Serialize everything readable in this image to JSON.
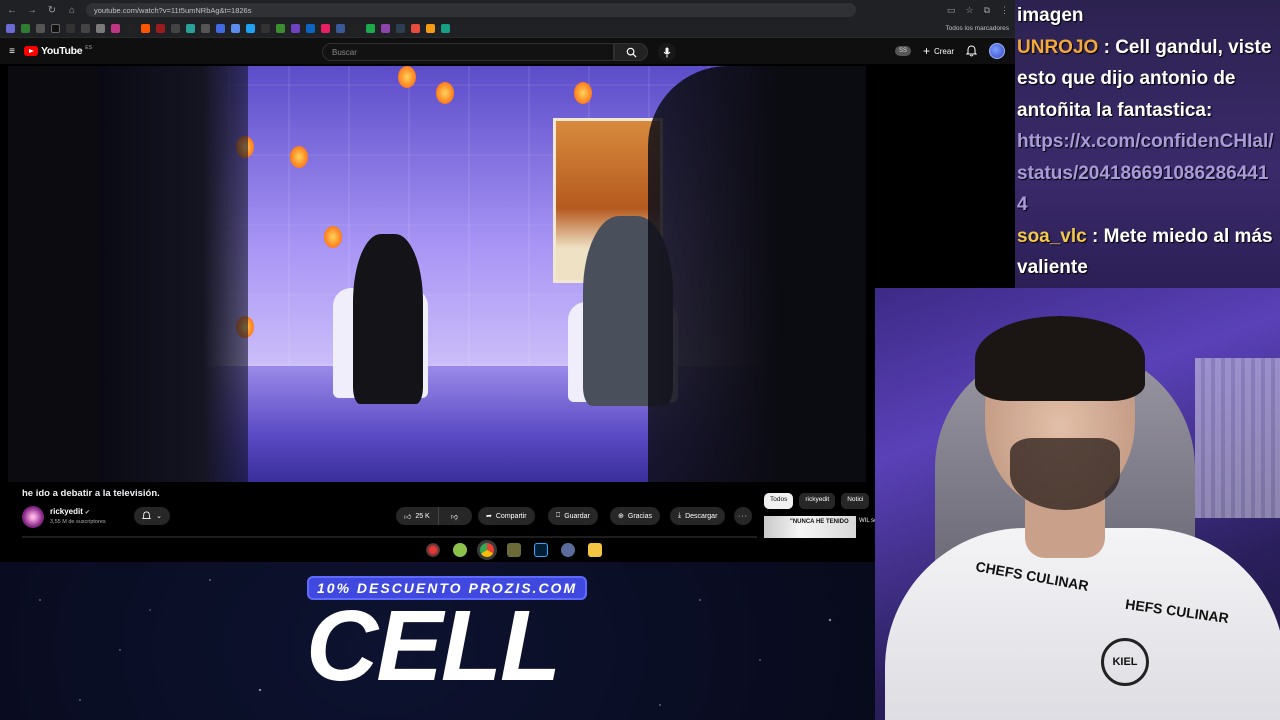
{
  "browser": {
    "url": "youtube.com/watch?v=11t5umNRbAg&t=1826s",
    "bookmarks_all_label": "Todos los marcadores"
  },
  "youtube": {
    "logo_text": "YouTube",
    "logo_sup": "ES",
    "search_placeholder": "Buscar",
    "create_label": "Crear",
    "badge": "SS"
  },
  "video": {
    "title": "he ido a debatir a la televisión.",
    "channel_name": "rickyedit",
    "subscribers": "3,55 M de suscriptores",
    "likes": "25 K",
    "share_label": "Compartir",
    "save_label": "Guardar",
    "thanks_label": "Gracias",
    "download_label": "Descargar"
  },
  "sidebar": {
    "chips": [
      "Todos",
      "rickyedit",
      "Notici"
    ],
    "rec_thumb_text": "\"NUNCA HE TENIDO",
    "rec_title": "WIL secr"
  },
  "chat": {
    "messages": [
      {
        "user": "",
        "text": "imagen"
      },
      {
        "user": "UNROJO",
        "text": "Cell gandul, viste esto que dijo antonio de antoñita la fantastica:"
      },
      {
        "link": "https://x.com/confidenCHIal/status/2041866910862864414"
      },
      {
        "user": "soa_vlc",
        "text": "Mete miedo al más valiente"
      }
    ]
  },
  "overlay": {
    "promo": "10% DESCUENTO PROZIS.COM",
    "name": "CELL"
  },
  "webcam": {
    "shirt_brand_1": "CHEFS CULINAR",
    "shirt_brand_2": "HEFS CULINAR",
    "badge_text": "KIEL"
  }
}
